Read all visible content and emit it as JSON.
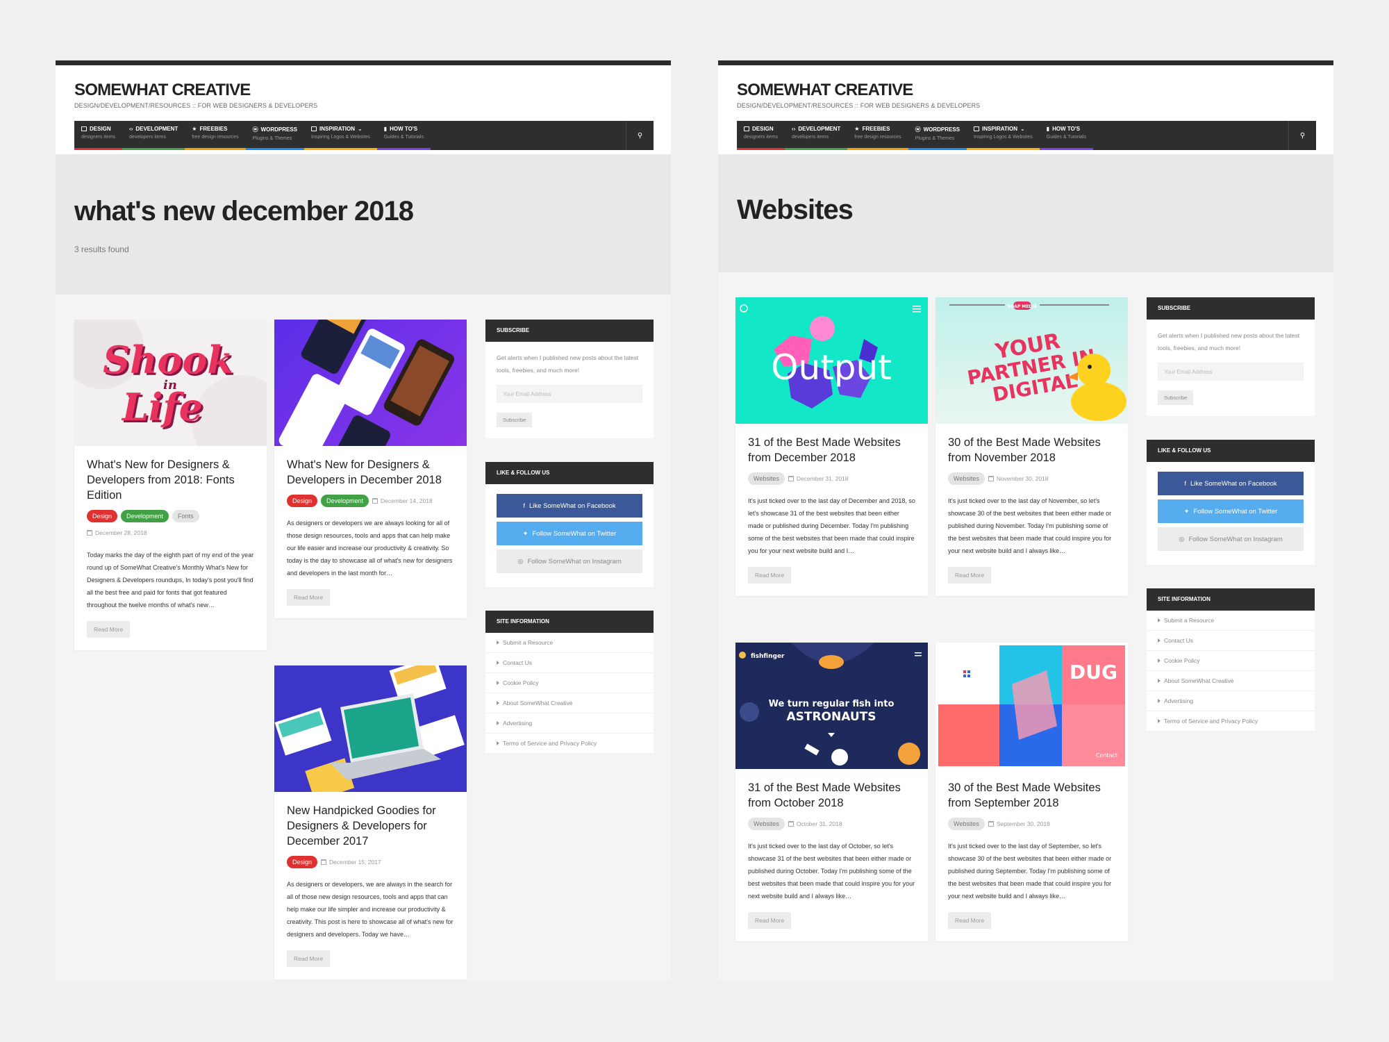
{
  "brand": {
    "title": "SOMEWHAT CREATIVE",
    "tagline": "DESIGN/DEVELOPMENT/RESOURCES :: FOR WEB DESIGNERS & DEVELOPERS"
  },
  "nav": [
    {
      "label": "DESIGN",
      "sub": "designers items",
      "color": "#e03131"
    },
    {
      "label": "DEVELOPMENT",
      "sub": "developers items",
      "color": "#43a047"
    },
    {
      "label": "FREEBIES",
      "sub": "free design resources",
      "color": "#f59f00"
    },
    {
      "label": "WORDPRESS",
      "sub": "Plugins & Themes",
      "color": "#1e88e5"
    },
    {
      "label": "INSPIRATION",
      "sub": "Inspiring Logos & Websites",
      "color": "#fab005"
    },
    {
      "label": "HOW TO'S",
      "sub": "Guides & Tutorials",
      "color": "#7b3fe4"
    }
  ],
  "left": {
    "page_title": "what's new december 2018",
    "results": "3 results found",
    "cards": [
      {
        "title": "What's New for Designers & Developers from 2018: Fonts Edition",
        "tags": [
          "Design",
          "Development",
          "Fonts"
        ],
        "date": "December 28, 2018",
        "excerpt": "Today marks the day of the eighth part of my end of the year round up of SomeWhat Creative's Monthly What's New for Designers & Developers roundups, In today's post you'll find all the best free and paid for fonts that got featured throughout the twelve months of what's new…",
        "read_more": "Read More",
        "thumb_text": [
          "Shook",
          "in",
          "Life"
        ]
      },
      {
        "title": "What's New for Designers & Developers in December 2018",
        "tags": [
          "Design",
          "Development"
        ],
        "date": "December 14, 2018",
        "excerpt": "As designers or developers we are always looking for all of those design resources, tools and apps that can help make our life easier and increase our productivity & creativity. So today is the day to showcase all of what's new for designers and developers in the last month for…",
        "read_more": "Read More"
      },
      {
        "title": "New Handpicked Goodies for Designers & Developers for December 2017",
        "tags": [
          "Design"
        ],
        "date": "December 15, 2017",
        "excerpt": "As designers or developers, we are always in the search for all of those new design resources, tools and apps that can help make our life simpler and increase our productivity & creativity. This post is here to showcase all of what's new for designers and developers. Today we have…",
        "read_more": "Read More"
      }
    ]
  },
  "right": {
    "page_title": "Websites",
    "cards": [
      {
        "title": "31 of the Best Made Websites from December 2018",
        "tag": "Websites",
        "date": "December 31, 2018",
        "excerpt": "It's just ticked over to the last day of December and 2018, so let's showcase 31 of the best websites that been either made or published during December. Today I'm publishing some of the best websites that been made that could inspire you for your next website build and I…",
        "read_more": "Read More",
        "thumb_text": "Output"
      },
      {
        "title": "30 of the Best Made Websites from November 2018",
        "tag": "Websites",
        "date": "November 30, 2018",
        "excerpt": "It's just ticked over to the last day of November, so let's showcase 30 of the best websites that been either made or published during November. Today I'm publishing some of the best websites that been made that could inspire you for your next website build and I always like…",
        "read_more": "Read More",
        "thumb_text": [
          "YOUR",
          "PARTNER IN",
          "DIGITAL"
        ],
        "thumb_logo": "SOAP MEDIA"
      },
      {
        "title": "31 of the Best Made Websites from October 2018",
        "tag": "Websites",
        "date": "October 31, 2018",
        "excerpt": "It's just ticked over to the last day of October, so let's showcase 31 of the best websites that been either made or published during October. Today I'm publishing some of the best websites that been made that could inspire you for your next website build and I always like…",
        "read_more": "Read More",
        "thumb_brand": "fishfinger",
        "thumb_line1": "We turn regular fish into",
        "thumb_line2": "ASTRONAUTS"
      },
      {
        "title": "30 of the Best Made Websites from September 2018",
        "tag": "Websites",
        "date": "September 30, 2018",
        "excerpt": "It's just ticked over to the last day of September, so let's showcase 30 of the best websites that been either made or published during September. Today I'm publishing some of the best websites that been made that could inspire you for your next website build and I always like…",
        "read_more": "Read More",
        "thumb_text": "DUG",
        "thumb_contact": "Contact"
      }
    ]
  },
  "sidebar": {
    "subscribe_head": "SUBSCRIBE",
    "subscribe_text": "Get alerts when I published new posts about the latest tools, freebies, and much more!",
    "email_placeholder": "Your Email Address",
    "subscribe_btn": "Subscribe",
    "follow_head": "LIKE & FOLLOW US",
    "facebook": "Like SomeWhat on Facebook",
    "twitter": "Follow SomeWhat on Twitter",
    "instagram": "Follow SomeWhat on Instagram",
    "info_head": "SITE INFORMATION",
    "info_items": [
      "Submit a Resource",
      "Contact Us",
      "Cookie Policy",
      "About SomeWhat Creative",
      "Advertising",
      "Terms of Service and Privacy Policy"
    ]
  },
  "colors": {
    "dark": "#2e2e2e",
    "design": "#e03131",
    "development": "#43a047",
    "facebook": "#3b5998",
    "twitter": "#55acee"
  }
}
